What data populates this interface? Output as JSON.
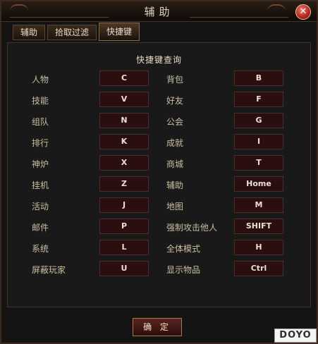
{
  "window": {
    "title": "辅助"
  },
  "tabs": [
    {
      "label": "辅助",
      "active": false
    },
    {
      "label": "拾取过滤",
      "active": false
    },
    {
      "label": "快捷键",
      "active": true
    }
  ],
  "panel": {
    "heading": "快捷键查询"
  },
  "hotkeys": [
    {
      "left_label": "人物",
      "left_key": "C",
      "right_label": "背包",
      "right_key": "B"
    },
    {
      "left_label": "技能",
      "left_key": "V",
      "right_label": "好友",
      "right_key": "F"
    },
    {
      "left_label": "组队",
      "left_key": "N",
      "right_label": "公会",
      "right_key": "G"
    },
    {
      "left_label": "排行",
      "left_key": "K",
      "right_label": "成就",
      "right_key": "I"
    },
    {
      "left_label": "神炉",
      "left_key": "X",
      "right_label": "商城",
      "right_key": "T"
    },
    {
      "left_label": "挂机",
      "left_key": "Z",
      "right_label": "辅助",
      "right_key": "Home"
    },
    {
      "left_label": "活动",
      "left_key": "J",
      "right_label": "地图",
      "right_key": "M"
    },
    {
      "left_label": "邮件",
      "left_key": "P",
      "right_label": "强制攻击他人",
      "right_key": "SHIFT"
    },
    {
      "left_label": "系统",
      "left_key": "L",
      "right_label": "全体模式",
      "right_key": "H"
    },
    {
      "left_label": "屏蔽玩家",
      "left_key": "U",
      "right_label": "显示物品",
      "right_key": "Ctrl"
    }
  ],
  "buttons": {
    "confirm": "确 定",
    "close_icon": "close-icon"
  },
  "watermark": "DOYO",
  "colors": {
    "accent_gold": "#a6784c",
    "key_background": "#2a0e10",
    "label_text": "#c9bf9f",
    "close_red": "#b1261c"
  }
}
